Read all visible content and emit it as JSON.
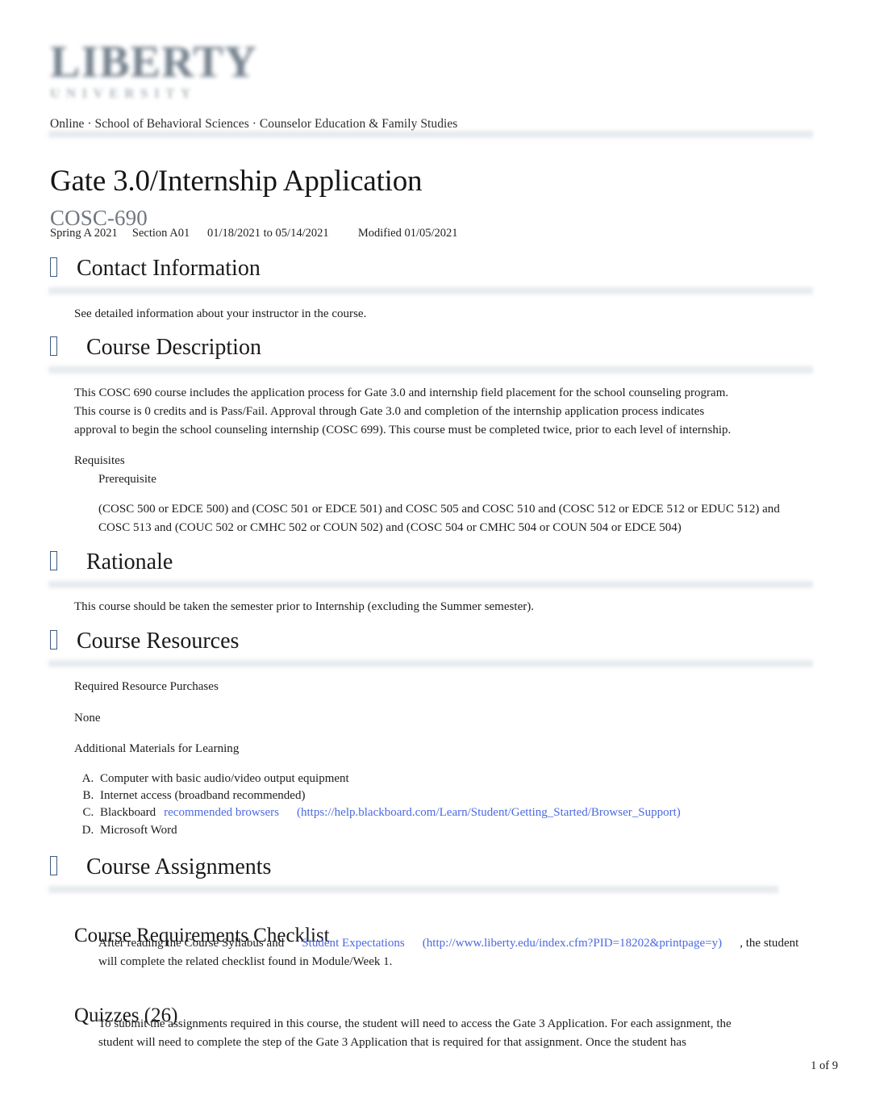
{
  "institution": {
    "logo_main": "LIBERTY",
    "logo_sub": "UNIVERSITY",
    "breadcrumb": "Online · School of Behavioral Sciences · Counselor Education & Family Studies"
  },
  "document": {
    "title": "Gate 3.0/Internship Application",
    "course_code": "COSC-690",
    "term": "Spring A 2021",
    "section": "Section A01",
    "date_range": "01/18/2021 to 05/14/2021",
    "modified": "Modified 01/05/2021",
    "meta_line": "Spring A 2021     Section A01      01/18/2021 to 05/14/2021          Modified 01/05/2021",
    "page_indicator": "1 of 9"
  },
  "sections": {
    "contact": {
      "heading": "Contact Information",
      "body": "See detailed information about your instructor in the course."
    },
    "description": {
      "heading": "Course Description",
      "paragraph": "This COSC 690 course includes the application process for Gate 3.0 and internship field placement for the school counseling program. This course is 0 credits and is Pass/Fail. Approval through Gate 3.0 and completion of the internship application process indicates approval to begin the school counseling internship (COSC 699). This course must be completed twice, prior to each level of internship.",
      "requisites_label": "Requisites",
      "prerequisite_label": "Prerequisite",
      "prerequisite_text": "(COSC 500 or EDCE 500) and (COSC 501 or EDCE 501) and COSC 505 and COSC 510 and (COSC 512 or EDCE 512 or EDUC 512) and COSC 513 and (COUC 502 or CMHC 502 or COUN 502) and (COSC 504 or CMHC 504 or COUN 504 or EDCE 504)"
    },
    "rationale": {
      "heading": "Rationale",
      "body": "This course should be taken the semester prior to Internship (excluding the Summer semester)."
    },
    "resources": {
      "heading": "Course Resources",
      "required_label": "Required Resource Purchases",
      "required_value": "None",
      "additional_label": "Additional Materials for Learning",
      "items": [
        {
          "text": "Computer with basic audio/video output equipment"
        },
        {
          "text": "Internet access (broadband recommended)"
        },
        {
          "text": "Blackboard",
          "link_text": "recommended browsers",
          "link_url": "(https://help.blackboard.com/Learn/Student/Getting_Started/Browser_Support)"
        },
        {
          "text": "Microsoft Word"
        }
      ]
    },
    "assignments": {
      "heading": "Course Assignments",
      "checklist": {
        "heading": "Course Requirements Checklist",
        "text_before": "After reading the Course Syllabus and",
        "link_text": "Student Expectations",
        "link_url": "(http://www.liberty.edu/index.cfm?PID=18202&printpage=y)",
        "text_after": ", the student will complete the related checklist found in Module/Week 1."
      },
      "quizzes": {
        "heading": "Quizzes (26)",
        "text": "To submit the assignments required in this course, the student will need to access the Gate 3 Application. For each assignment, the student will need to complete the step of the Gate 3 Application that is required for that assignment. Once the student has"
      }
    }
  },
  "colors": {
    "link": "#4a69e2",
    "heading": "#1a1a1a",
    "subtitle": "#6f7780",
    "tofu_border": "#3d5a80",
    "divider": "#e2e8eb"
  }
}
